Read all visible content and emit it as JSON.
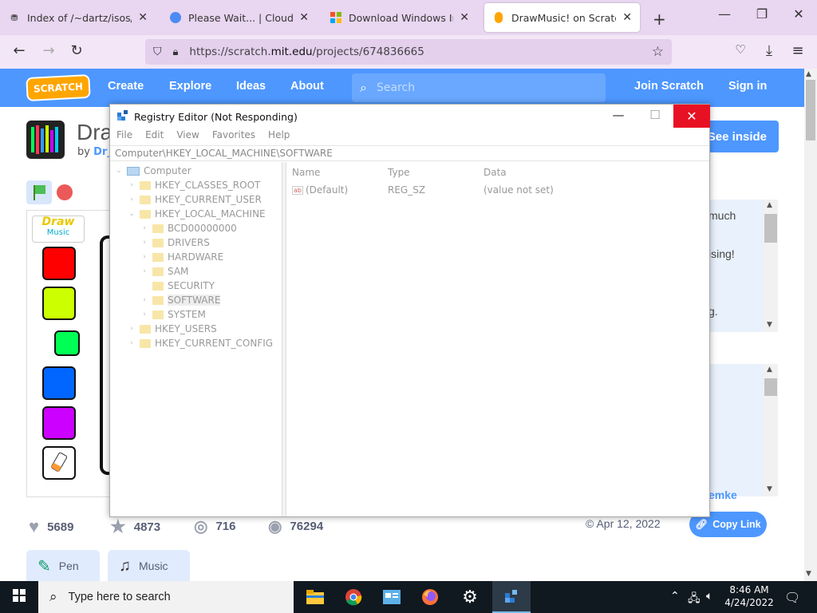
{
  "browser": {
    "tabs": [
      {
        "label": "Index of /~dartz/isos/",
        "icon": "server-icon"
      },
      {
        "label": "Please Wait... | Cloudflare",
        "icon": "cloudflare-icon"
      },
      {
        "label": "Download Windows Insider",
        "icon": "windows-logo-icon"
      },
      {
        "label": "DrawMusic! on Scratch",
        "icon": "scratch-icon"
      }
    ],
    "url_prefix": "https://scratch.",
    "url_domain": "mit.edu",
    "url_path": "/projects/674836665"
  },
  "scratch": {
    "logo": "SCRATCH",
    "nav": [
      "Create",
      "Explore",
      "Ideas",
      "About"
    ],
    "search_placeholder": "Search",
    "join": "Join Scratch",
    "signin": "Sign in",
    "project_title": "Dra",
    "by": "by",
    "author": "Dr_",
    "see_inside": "See inside",
    "stage_logo_top": "Draw",
    "stage_logo_bottom": "Music",
    "swatch_colors": [
      "#ff0000",
      "#ccff00",
      "#00ff55",
      "#0066ff",
      "#cc00ff"
    ],
    "desc_lines": [
      "much",
      "ising!",
      "g."
    ],
    "desc2_link": "emke",
    "stats": {
      "loves": "5689",
      "favorites": "4873",
      "remixes": "716",
      "views": "76294"
    },
    "date": "Apr 12, 2022",
    "copy_link": "Copy Link",
    "extensions": [
      "Pen",
      "Music"
    ]
  },
  "regedit": {
    "title": "Registry Editor (Not Responding)",
    "menu": [
      "File",
      "Edit",
      "View",
      "Favorites",
      "Help"
    ],
    "address": "Computer\\HKEY_LOCAL_MACHINE\\SOFTWARE",
    "tree": {
      "root": "Computer",
      "hives": [
        "HKEY_CLASSES_ROOT",
        "HKEY_CURRENT_USER",
        "HKEY_LOCAL_MACHINE",
        "HKEY_USERS",
        "HKEY_CURRENT_CONFIG"
      ],
      "hklm_children": [
        "BCD00000000",
        "DRIVERS",
        "HARDWARE",
        "SAM",
        "SECURITY",
        "SOFTWARE",
        "SYSTEM"
      ],
      "selected": "SOFTWARE"
    },
    "columns": [
      "Name",
      "Type",
      "Data"
    ],
    "values": [
      {
        "name": "(Default)",
        "type": "REG_SZ",
        "data": "(value not set)"
      }
    ]
  },
  "taskbar": {
    "search_placeholder": "Type here to search",
    "time": "8:46 AM",
    "date": "4/24/2022"
  }
}
